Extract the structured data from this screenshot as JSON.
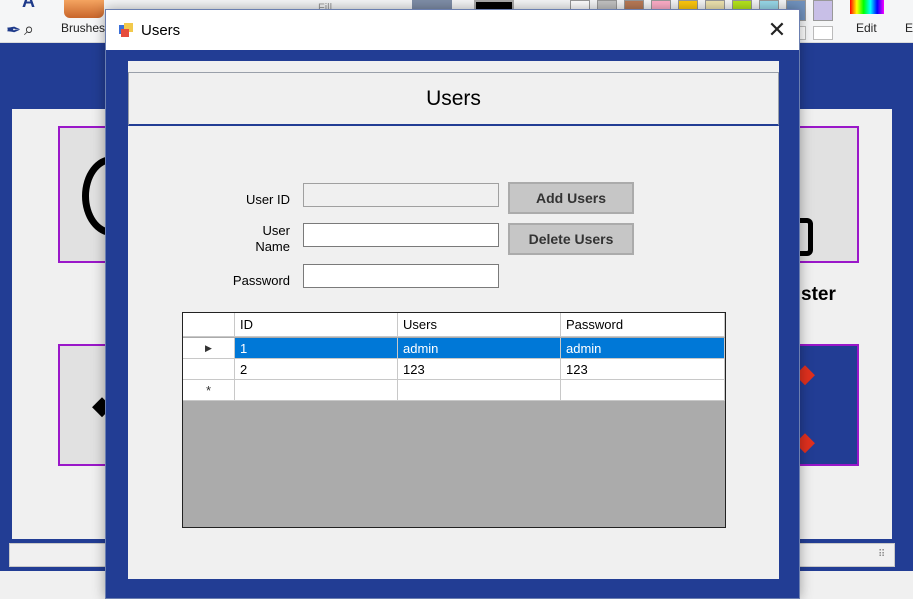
{
  "background_app": {
    "ribbon": {
      "brushes_label": "Brushes",
      "fill_label": "Fill",
      "edit_colors_label": "Edit",
      "partial_label": "E"
    },
    "tile_text": "ster",
    "colors": {
      "canvas": "#223d94",
      "tile_border": "#9a17c9",
      "arrow": "#e0301e"
    },
    "palette_top": [
      "#ffffff",
      "#c3c3c3",
      "#b97a57",
      "#ffaec9",
      "#ffc90e",
      "#efe4b0",
      "#b5e61d",
      "#99d9ea",
      "#7092be",
      "#c8bfe7"
    ]
  },
  "dialog": {
    "window_title": "Users",
    "close_glyph": "✕",
    "header_title": "Users",
    "form": {
      "user_id_label": "User ID",
      "user_name_label": "User\nName",
      "password_label": "Password",
      "user_id_value": "",
      "user_name_value": "",
      "password_value": "",
      "add_button": "Add Users",
      "delete_button": "Delete Users"
    },
    "grid": {
      "columns": [
        "ID",
        "Users",
        "Password"
      ],
      "rows": [
        {
          "id": "1",
          "user": "admin",
          "password": "admin",
          "selected": true,
          "marker": "▶"
        },
        {
          "id": "2",
          "user": "123",
          "password": "123",
          "selected": false,
          "marker": ""
        }
      ],
      "new_row_marker": "*",
      "selection_color": "#0078d7"
    }
  }
}
